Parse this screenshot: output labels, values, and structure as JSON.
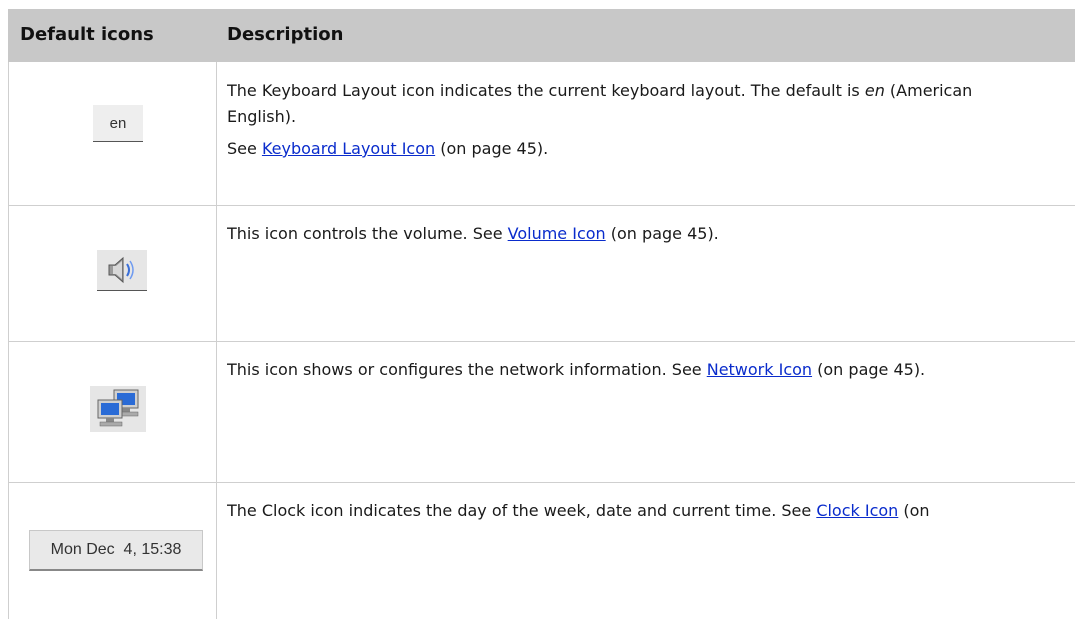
{
  "header": {
    "col1": "Default icons",
    "col2": "Description"
  },
  "rows": [
    {
      "icon_name": "keyboard-layout-icon",
      "icon_text": "en",
      "text_before": "The Keyboard Layout icon indicates the current keyboard layout. The default is ",
      "text_em": "en",
      "text_after": " (American",
      "text_line2": "English).",
      "see": "See ",
      "link": "Keyboard Layout Icon",
      "page_ref": " (on page 45)."
    },
    {
      "icon_name": "speaker-icon",
      "text_before": "This icon controls the volume. See ",
      "link": "Volume Icon",
      "page_ref": " (on page 45)."
    },
    {
      "icon_name": "network-icon",
      "text_before": "This icon shows or configures the network information. See ",
      "link": "Network Icon",
      "page_ref": " (on page 45)."
    },
    {
      "icon_name": "clock-icon",
      "icon_text": "Mon Dec  4, 15:38",
      "text_before": "The Clock icon indicates the day of the week, date and current time. See ",
      "link": "Clock Icon",
      "page_ref": " (on"
    }
  ]
}
